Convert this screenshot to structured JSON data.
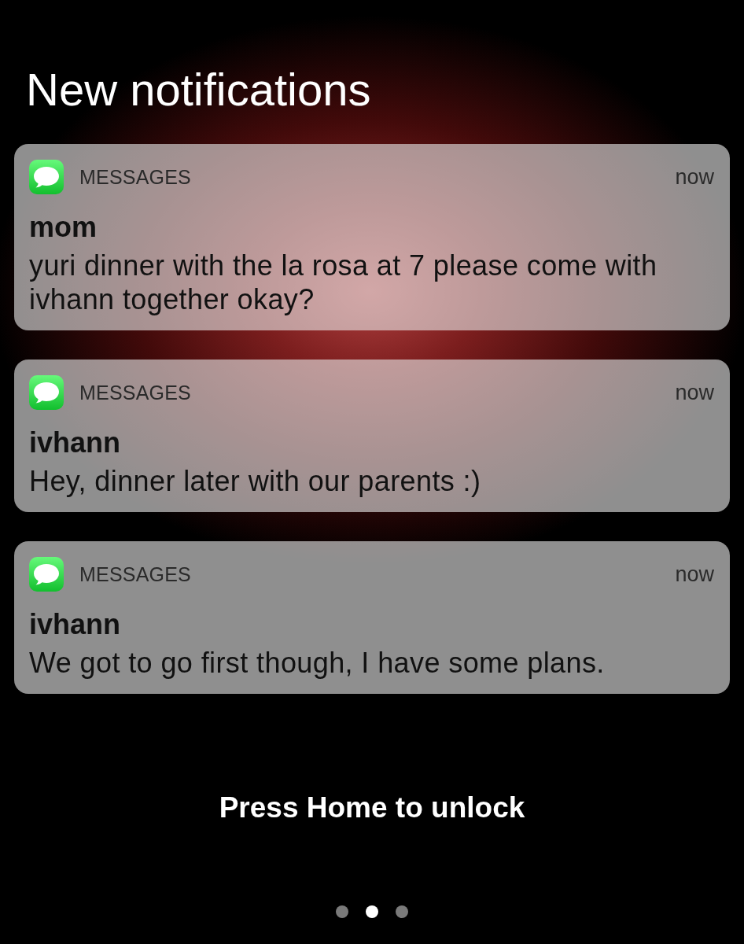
{
  "title": "New notifications",
  "notifications": [
    {
      "app": "MESSAGES",
      "time": "now",
      "sender": "mom",
      "message": "yuri dinner with the la rosa at 7 please come with ivhann together okay?"
    },
    {
      "app": "MESSAGES",
      "time": "now",
      "sender": "ivhann",
      "message": "Hey, dinner later with our parents :)"
    },
    {
      "app": "MESSAGES",
      "time": "now",
      "sender": "ivhann",
      "message": "We got to go first though, I have some plans."
    }
  ],
  "unlock_hint": "Press Home to unlock",
  "page_dots": [
    {
      "selected": false
    },
    {
      "selected": true
    },
    {
      "selected": false
    }
  ]
}
